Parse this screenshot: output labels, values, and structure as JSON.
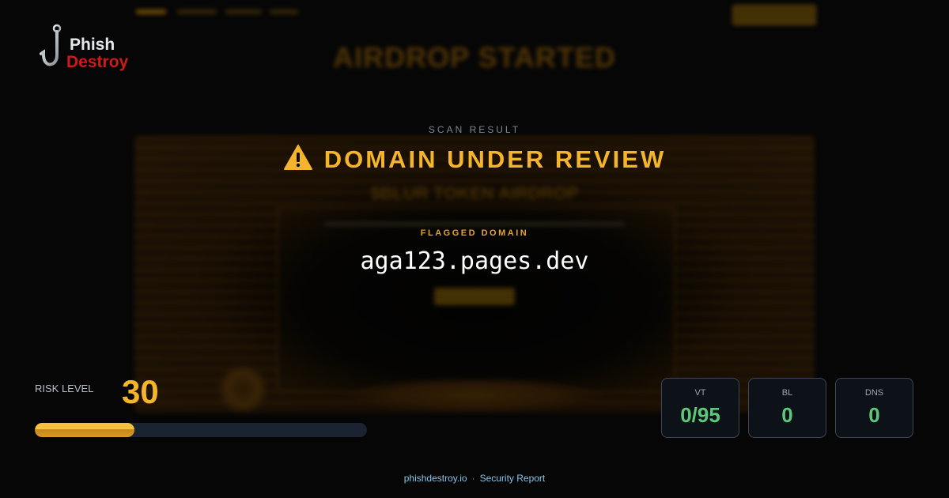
{
  "brand": {
    "line1": "Phish",
    "line2": "Destroy",
    "colors": {
      "phish": "#e6e8ea",
      "destroy": "#d11919"
    },
    "icon": "fish-hook-icon"
  },
  "background_preview": {
    "headline": "AIRDROP STARTED",
    "subheadline": "$BLUR TOKEN AIRDROP"
  },
  "scan": {
    "section_label": "SCAN RESULT",
    "verdict": "DOMAIN UNDER REVIEW",
    "verdict_icon": "warning-triangle-icon",
    "flagged_label": "FLAGGED DOMAIN",
    "domain": "aga123.pages.dev"
  },
  "risk": {
    "label": "RISK LEVEL",
    "value": "30",
    "fill_percent": 30,
    "color": "#f5b52b"
  },
  "stats": [
    {
      "label": "VT",
      "value": "0/95"
    },
    {
      "label": "BL",
      "value": "0"
    },
    {
      "label": "DNS",
      "value": "0"
    }
  ],
  "footer": {
    "site": "phishdestroy.io",
    "separator": "·",
    "report": "Security Report"
  },
  "colors": {
    "accent": "#f5b52b",
    "ok_green": "#5cc878",
    "background": "#060606"
  }
}
